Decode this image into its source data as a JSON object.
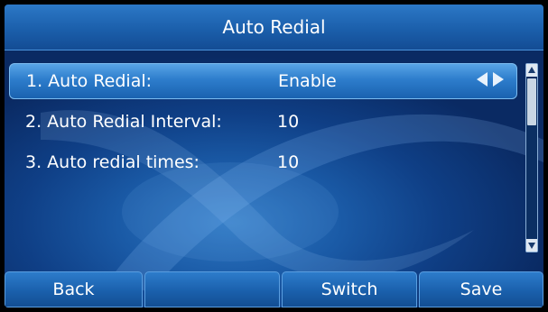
{
  "title": "Auto Redial",
  "rows": [
    {
      "label": "1. Auto Redial:",
      "value": "Enable"
    },
    {
      "label": "2. Auto Redial Interval:",
      "value": "10"
    },
    {
      "label": "3. Auto redial times:",
      "value": "10"
    }
  ],
  "selected_row": 1,
  "softkeys": [
    "Back",
    "",
    "Switch",
    "Save"
  ],
  "colors": {
    "accent": "#1b5fab",
    "highlight": "#2d7dcc",
    "text": "#ffffff"
  }
}
